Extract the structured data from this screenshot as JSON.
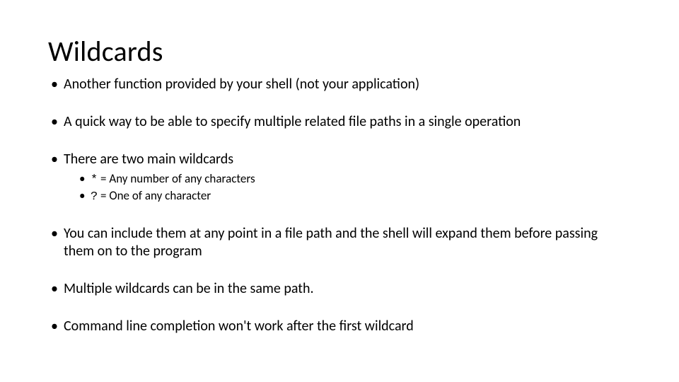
{
  "title": "Wildcards",
  "bullets": {
    "b1": "Another function provided by your shell (not your application)",
    "b2": "A quick way to be able to specify multiple related file paths in a single operation",
    "b3": "There are two main wildcards",
    "b3_sub1_sym": "*",
    "b3_sub1_rest": " = Any number of any characters",
    "b3_sub2_sym": "?",
    "b3_sub2_rest": " = One of any character",
    "b4": "You can include them at any point in a file path and the shell will expand them before passing them on to the program",
    "b5": "Multiple wildcards can be in the same path.",
    "b6": "Command line completion won't work after the first wildcard"
  }
}
